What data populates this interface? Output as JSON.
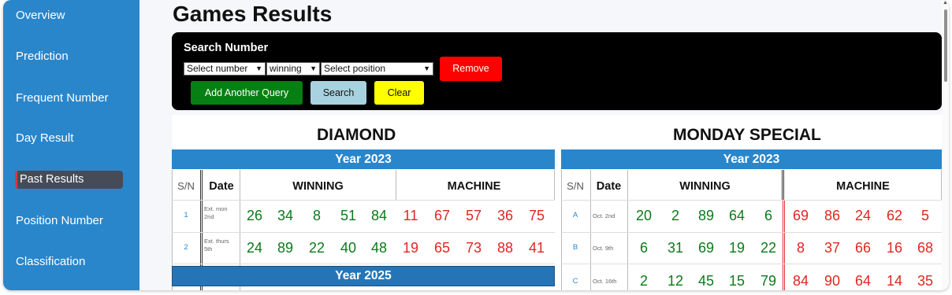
{
  "sidebar": {
    "items": [
      {
        "label": "Overview"
      },
      {
        "label": "Prediction"
      },
      {
        "label": "Frequent Number"
      },
      {
        "label": "Day Result"
      },
      {
        "label": "Past Results"
      },
      {
        "label": "Position Number"
      },
      {
        "label": "Classification"
      }
    ],
    "active_index": 4
  },
  "page": {
    "title": "Games Results"
  },
  "search": {
    "title": "Search Number",
    "select_number": "Select number",
    "select_type": "winning",
    "select_position": "Select position",
    "remove_label": "Remove",
    "add_label": "Add Another Query",
    "search_label": "Search",
    "clear_label": "Clear"
  },
  "columns": {
    "sn": "S/N",
    "date": "Date",
    "winning": "WINNING",
    "machine": "MACHINE"
  },
  "games": [
    {
      "name": "DIAMOND",
      "year_2023": "Year 2023",
      "year_2025": "Year 2025",
      "rows": [
        {
          "sn": "1",
          "date": "Ext. mon 2nd",
          "winning": [
            "26",
            "34",
            "8",
            "51",
            "84"
          ],
          "machine": [
            "11",
            "67",
            "57",
            "36",
            "75"
          ]
        },
        {
          "sn": "2",
          "date": "Ext. thurs 5th",
          "winning": [
            "24",
            "89",
            "22",
            "40",
            "48"
          ],
          "machine": [
            "19",
            "65",
            "73",
            "88",
            "41"
          ]
        }
      ]
    },
    {
      "name": "MONDAY SPECIAL",
      "year_2023": "Year 2023",
      "rows": [
        {
          "sn": "A",
          "date": "Oct. 2nd",
          "winning": [
            "20",
            "2",
            "89",
            "64",
            "6"
          ],
          "machine": [
            "69",
            "86",
            "24",
            "62",
            "5"
          ]
        },
        {
          "sn": "B",
          "date": "Oct. 9th",
          "winning": [
            "6",
            "31",
            "69",
            "19",
            "22"
          ],
          "machine": [
            "8",
            "37",
            "66",
            "16",
            "68"
          ]
        },
        {
          "sn": "C",
          "date": "Oct. 16th",
          "winning": [
            "2",
            "12",
            "45",
            "15",
            "79"
          ],
          "machine": [
            "84",
            "90",
            "64",
            "14",
            "35"
          ]
        }
      ]
    }
  ],
  "colors": {
    "sidebar": "#2a86cb",
    "winning": "#0a7a1a",
    "machine": "#e0261f",
    "remove": "#ff0000",
    "add": "#078013",
    "clear": "#ffff00",
    "search": "#a9d2e0"
  },
  "icons": [
    "chevron-down-icon",
    "scroll-up-arrow-icon"
  ]
}
